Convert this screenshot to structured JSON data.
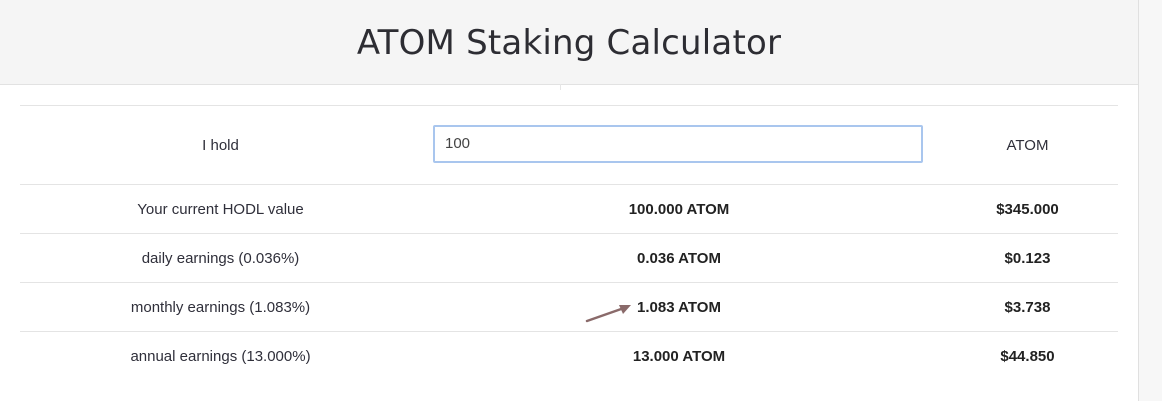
{
  "header": {
    "title": "ATOM Staking Calculator"
  },
  "input_row": {
    "label": "I hold",
    "value": "100",
    "unit": "ATOM"
  },
  "rows": [
    {
      "label": "Your current HODL value",
      "atom": "100.000 ATOM",
      "usd": "$345.000"
    },
    {
      "label": "daily earnings (0.036%)",
      "atom": "0.036 ATOM",
      "usd": "$0.123"
    },
    {
      "label": "monthly earnings (1.083%)",
      "atom": "1.083 ATOM",
      "usd": "$3.738"
    },
    {
      "label": "annual earnings (13.000%)",
      "atom": "13.000 ATOM",
      "usd": "$44.850"
    }
  ],
  "colors": {
    "header_bg": "#f5f5f5",
    "input_border": "#a9c6ee",
    "arrow": "#8a6a6a"
  }
}
